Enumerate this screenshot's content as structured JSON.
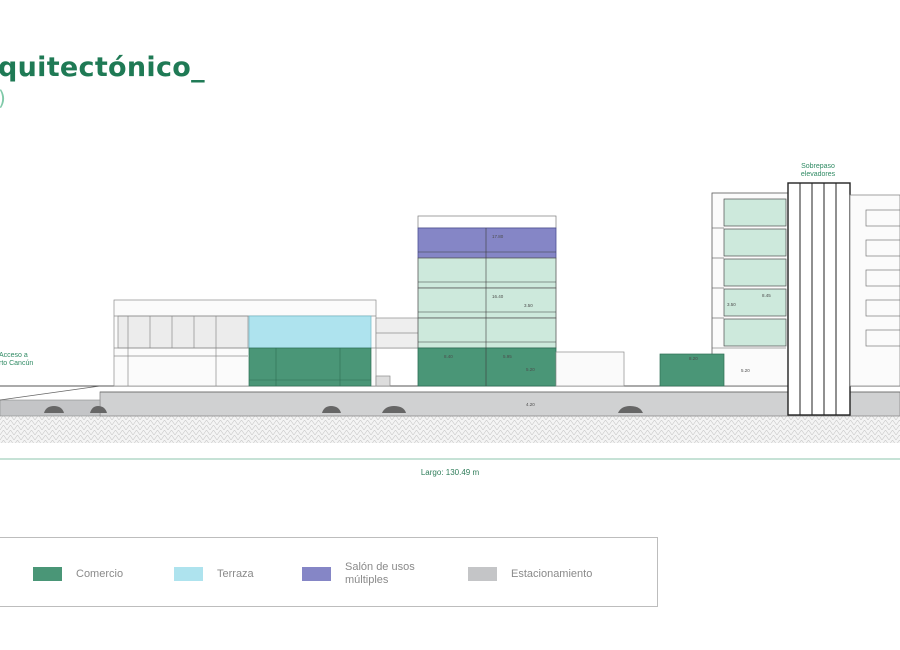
{
  "heading": {
    "title": "quitectónico_",
    "subtitle": ")"
  },
  "annotations": {
    "access_line1": "Acceso a",
    "access_line2": "rto Cancún",
    "overpass_line1": "Sobrepaso",
    "overpass_line2": "elevadores"
  },
  "dimensions": {
    "total_length": "Largo: 130.49 m",
    "sum_top": "17.80",
    "middle_span": "16.40",
    "middle_height": "3.50",
    "ground_left": "8.40",
    "ground_right": "5.95",
    "ground_height": "5.20",
    "basement_height": "4.20",
    "right_span": "8.45",
    "right_height": "3.50",
    "right_low": "8.20",
    "right_ground": "5.20"
  },
  "legend": {
    "items": [
      {
        "label": "Comercio",
        "color": "#4a9677"
      },
      {
        "label": "Terraza",
        "color": "#aee3ee"
      },
      {
        "label_line1": "Salón de usos",
        "label_line2": "múltiples",
        "color": "#8586c6"
      },
      {
        "label": "Estacionamiento",
        "color": "#c4c5c7"
      }
    ]
  },
  "colors": {
    "brand_green": "#1f7a55",
    "comercio": "#4a9677",
    "terraza": "#aee3ee",
    "salon": "#8586c6",
    "estacionamiento": "#c4c5c7",
    "glass_green": "#cde9dc"
  }
}
